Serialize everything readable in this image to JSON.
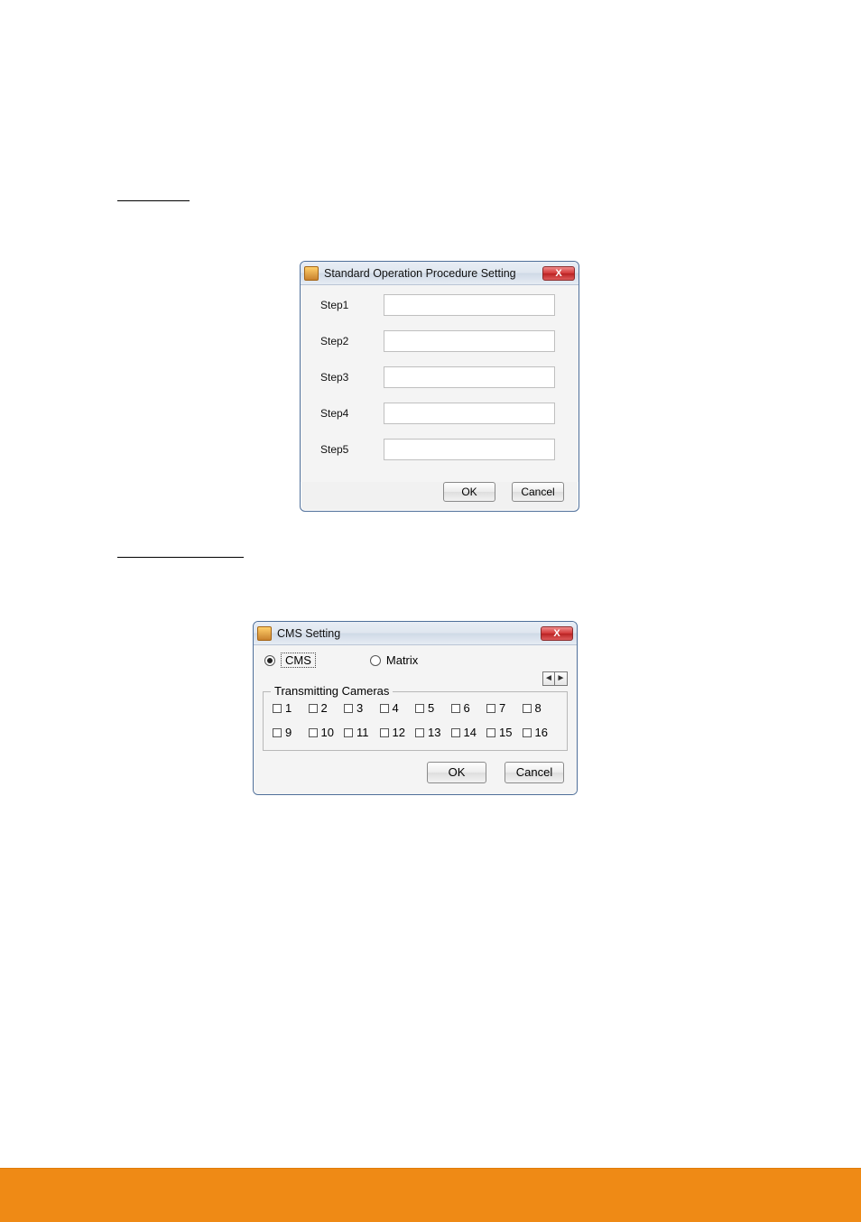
{
  "section1": {
    "heading_underlined": " ",
    "intro_para": " "
  },
  "sop_dialog": {
    "title": "Standard Operation Procedure Setting",
    "close_glyph": "X",
    "steps": [
      {
        "label": "Step1",
        "value": ""
      },
      {
        "label": "Step2",
        "value": ""
      },
      {
        "label": "Step3",
        "value": ""
      },
      {
        "label": "Step4",
        "value": ""
      },
      {
        "label": "Step5",
        "value": ""
      }
    ],
    "ok_label": "OK",
    "cancel_label": "Cancel"
  },
  "section2": {
    "heading_underlined": " ",
    "intro_para": " "
  },
  "cms_dialog": {
    "title": "CMS Setting",
    "close_glyph": "X",
    "mode_options": [
      {
        "label": "CMS",
        "selected": true
      },
      {
        "label": "Matrix",
        "selected": false
      }
    ],
    "arrow_left": "◄",
    "arrow_right": "►",
    "group_label": "Transmitting Cameras",
    "cameras_row1": [
      "1",
      "2",
      "3",
      "4",
      "5",
      "6",
      "7",
      "8"
    ],
    "cameras_row2": [
      "9",
      "10",
      "11",
      "12",
      "13",
      "14",
      "15",
      "16"
    ],
    "ok_label": "OK",
    "cancel_label": "Cancel"
  },
  "footer": {
    "page_num": ""
  }
}
